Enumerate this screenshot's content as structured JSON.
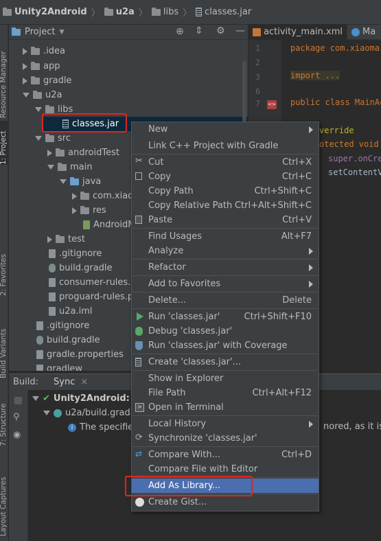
{
  "breadcrumb": {
    "project": "Unity2Android",
    "module": "u2a",
    "folder": "libs",
    "file": "classes.jar"
  },
  "left_strip": {
    "resource_manager": "Resource Manager",
    "project": "1: Project",
    "favorites": "2: Favorites",
    "build_variants": "Build Variants",
    "structure": "7: Structure",
    "layout_captures": "Layout Captures"
  },
  "project_panel": {
    "title": "Project",
    "tree": [
      {
        "label": ".idea"
      },
      {
        "label": "app"
      },
      {
        "label": "gradle"
      },
      {
        "label": "u2a"
      },
      {
        "label": "libs"
      },
      {
        "label": "classes.jar"
      },
      {
        "label": "src"
      },
      {
        "label": "androidTest"
      },
      {
        "label": "main"
      },
      {
        "label": "java"
      },
      {
        "label": "com.xiaoma"
      },
      {
        "label": "res"
      },
      {
        "label": "AndroidMa"
      },
      {
        "label": "test"
      },
      {
        "label": ".gitignore"
      },
      {
        "label": "build.gradle"
      },
      {
        "label": "consumer-rules.pr"
      },
      {
        "label": "proguard-rules.pr"
      },
      {
        "label": "u2a.iml"
      },
      {
        "label": ".gitignore"
      },
      {
        "label": "build.gradle"
      },
      {
        "label": "gradle.properties"
      },
      {
        "label": "gradlew"
      }
    ]
  },
  "editor": {
    "tabs": [
      {
        "label": "activity_main.xml"
      },
      {
        "label": "Ma"
      }
    ],
    "line_numbers": [
      "1",
      "2",
      "3",
      "6",
      "7"
    ],
    "lines": {
      "l1": "package com.xiaoma.",
      "l3": "import ...",
      "l7": "public class MainAc",
      "l9": "verride",
      "l10": "otected void",
      "l11": "super.onCre",
      "l12": "setContentV"
    },
    "gutter_badge": "<>"
  },
  "build_panel": {
    "label": "Build:",
    "tab": "Sync",
    "close": "×",
    "tree": [
      {
        "label": "Unity2Android: su"
      },
      {
        "label": "u2a/build.gradle"
      },
      {
        "label": "The specified"
      }
    ],
    "right_text": "nored, as it is be"
  },
  "context_menu": {
    "items": [
      {
        "label": "New",
        "shortcut": ""
      },
      {
        "label": "Link C++ Project with Gradle",
        "shortcut": ""
      },
      {
        "label": "Cut",
        "shortcut": "Ctrl+X"
      },
      {
        "label": "Copy",
        "shortcut": "Ctrl+C"
      },
      {
        "label": "Copy Path",
        "shortcut": "Ctrl+Shift+C"
      },
      {
        "label": "Copy Relative Path",
        "shortcut": "Ctrl+Alt+Shift+C"
      },
      {
        "label": "Paste",
        "shortcut": "Ctrl+V"
      },
      {
        "label": "Find Usages",
        "shortcut": "Alt+F7"
      },
      {
        "label": "Analyze",
        "shortcut": ""
      },
      {
        "label": "Refactor",
        "shortcut": ""
      },
      {
        "label": "Add to Favorites",
        "shortcut": ""
      },
      {
        "label": "Delete...",
        "shortcut": "Delete"
      },
      {
        "label": "Run 'classes.jar'",
        "shortcut": "Ctrl+Shift+F10"
      },
      {
        "label": "Debug 'classes.jar'",
        "shortcut": ""
      },
      {
        "label": "Run 'classes.jar' with Coverage",
        "shortcut": ""
      },
      {
        "label": "Create 'classes.jar'...",
        "shortcut": ""
      },
      {
        "label": "Show in Explorer",
        "shortcut": ""
      },
      {
        "label": "File Path",
        "shortcut": "Ctrl+Alt+F12"
      },
      {
        "label": "Open in Terminal",
        "shortcut": ""
      },
      {
        "label": "Local History",
        "shortcut": ""
      },
      {
        "label": "Synchronize 'classes.jar'",
        "shortcut": ""
      },
      {
        "label": "Compare With...",
        "shortcut": "Ctrl+D"
      },
      {
        "label": "Compare File with Editor",
        "shortcut": ""
      },
      {
        "label": "Add As Library...",
        "shortcut": ""
      },
      {
        "label": "Create Gist...",
        "shortcut": ""
      }
    ]
  },
  "colors": {
    "menu_highlight": "#4b6eaf",
    "annotation_red": "#e0261e",
    "selection": "#0d293e"
  }
}
